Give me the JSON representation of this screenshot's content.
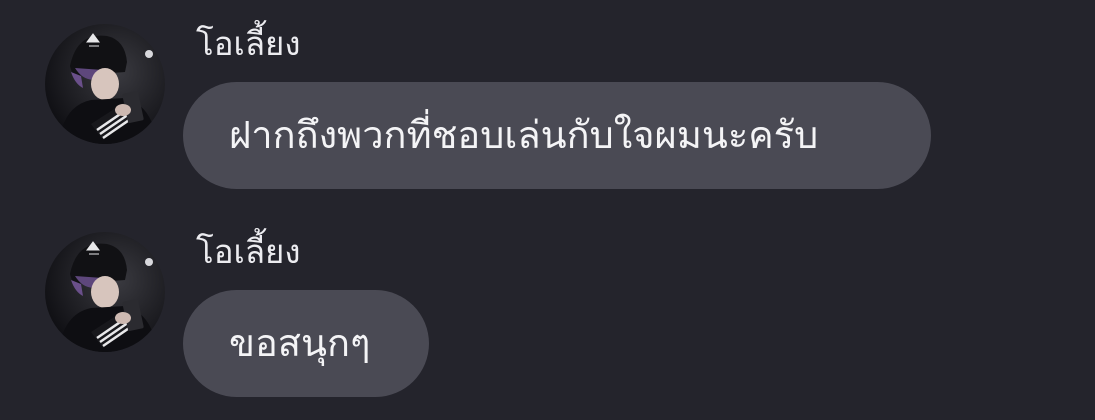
{
  "messages": [
    {
      "sender": "โอเลี้ยง",
      "text": "ฝากถึงพวกที่ชอบเล่นกับใจผมนะครับ",
      "avatar_icon": "user-avatar-photo"
    },
    {
      "sender": "โอเลี้ยง",
      "text": "ขอสนุกๆ",
      "avatar_icon": "user-avatar-photo"
    }
  ],
  "colors": {
    "background": "#24242c",
    "bubble": "#4a4a54",
    "text": "#f4f4f6",
    "sender": "#ececf0"
  }
}
